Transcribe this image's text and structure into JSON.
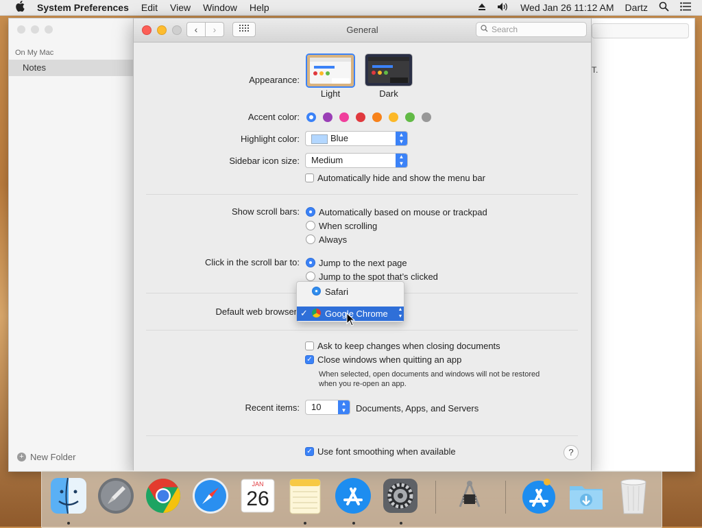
{
  "menubar": {
    "app_name": "System Preferences",
    "items": [
      "Edit",
      "View",
      "Window",
      "Help"
    ],
    "clock": "Wed Jan 26  11:12 AM",
    "user": "Dartz"
  },
  "notes_window": {
    "section": "On My Mac",
    "folder": "Notes",
    "new_folder": "New Folder",
    "stray_text": "T."
  },
  "prefs": {
    "title": "General",
    "search_placeholder": "Search",
    "appearance": {
      "label": "Appearance:",
      "options": [
        "Light",
        "Dark"
      ],
      "selected": "Light"
    },
    "accent": {
      "label": "Accent color:",
      "colors": [
        "#3b82f7",
        "#9a3fb6",
        "#f03f9c",
        "#e0393e",
        "#f7821b",
        "#fcb827",
        "#62ba46",
        "#989898"
      ],
      "selected": 0
    },
    "highlight": {
      "label": "Highlight color:",
      "value": "Blue",
      "swatch": "#b3d7ff"
    },
    "sidebar_icon": {
      "label": "Sidebar icon size:",
      "value": "Medium"
    },
    "autohide_menubar": {
      "label": "Automatically hide and show the menu bar",
      "checked": false
    },
    "scroll_bars": {
      "label": "Show scroll bars:",
      "options": [
        "Automatically based on mouse or trackpad",
        "When scrolling",
        "Always"
      ],
      "selected": 0
    },
    "click_scroll": {
      "label": "Click in the scroll bar to:",
      "options": [
        "Jump to the next page",
        "Jump to the spot that’s clicked"
      ],
      "selected": 0
    },
    "browser": {
      "label": "Default web browser",
      "menu": [
        "Safari",
        "Google Chrome"
      ],
      "selected": "Google Chrome"
    },
    "ask_keep_changes": {
      "label": "Ask to keep changes when closing documents",
      "checked": false
    },
    "close_windows": {
      "label": "Close windows when quitting an app",
      "checked": true
    },
    "close_windows_note_1": "When selected, open documents and windows will not be restored",
    "close_windows_note_2": "when you re-open an app.",
    "recent": {
      "label": "Recent items:",
      "value": "10",
      "suffix": "Documents, Apps, and Servers"
    },
    "font_smoothing": {
      "label": "Use font smoothing when available",
      "checked": true
    },
    "help": "?"
  },
  "dock": {
    "apps": [
      "Finder",
      "Launchpad",
      "Google Chrome",
      "Safari",
      "Calendar",
      "Notes",
      "App Store",
      "System Preferences",
      "System Information",
      "App Store Installer",
      "Downloads",
      "Trash"
    ],
    "calendar_month": "JAN",
    "calendar_day": "26"
  }
}
